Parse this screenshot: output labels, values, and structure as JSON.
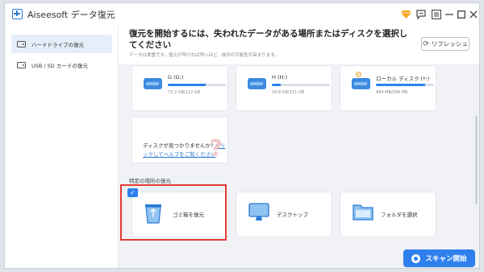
{
  "window": {
    "title": "Aiseesoft データ復元"
  },
  "sidebar": {
    "items": [
      {
        "label": "ハードドライブの復元"
      },
      {
        "label": "USB / SD カードの復元"
      }
    ]
  },
  "main": {
    "headline": "復元を開始するには、失われたデータがある場所またはディスクを選択してください",
    "subline": "データは貴重です。復元が早ければ早いほど、成功の可能性が高まります。",
    "refresh_label": "リフレッシュ",
    "drives": [
      {
        "name": "G (G:)",
        "size": "73.2 GB/112 GB",
        "usage": 0.65
      },
      {
        "name": "H (H:)",
        "size": "16.8 GB/111 GB",
        "usage": 0.15
      },
      {
        "name": "ローカル ディスク (*:)",
        "size": "494 MB/584 MB",
        "usage": 0.85
      }
    ],
    "help": {
      "prefix": "ディスクが見つかりませんか? ",
      "link": "クリックしてヘルプをご覧ください"
    },
    "section_title": "特定の場所の復元",
    "locations": [
      {
        "label": "ゴミ箱を復元"
      },
      {
        "label": "デスクトップ"
      },
      {
        "label": "フォルダを選択"
      }
    ],
    "scan_label": "スキャン開始"
  },
  "colors": {
    "accent": "#2f80ed",
    "highlight_border": "#e53935"
  }
}
